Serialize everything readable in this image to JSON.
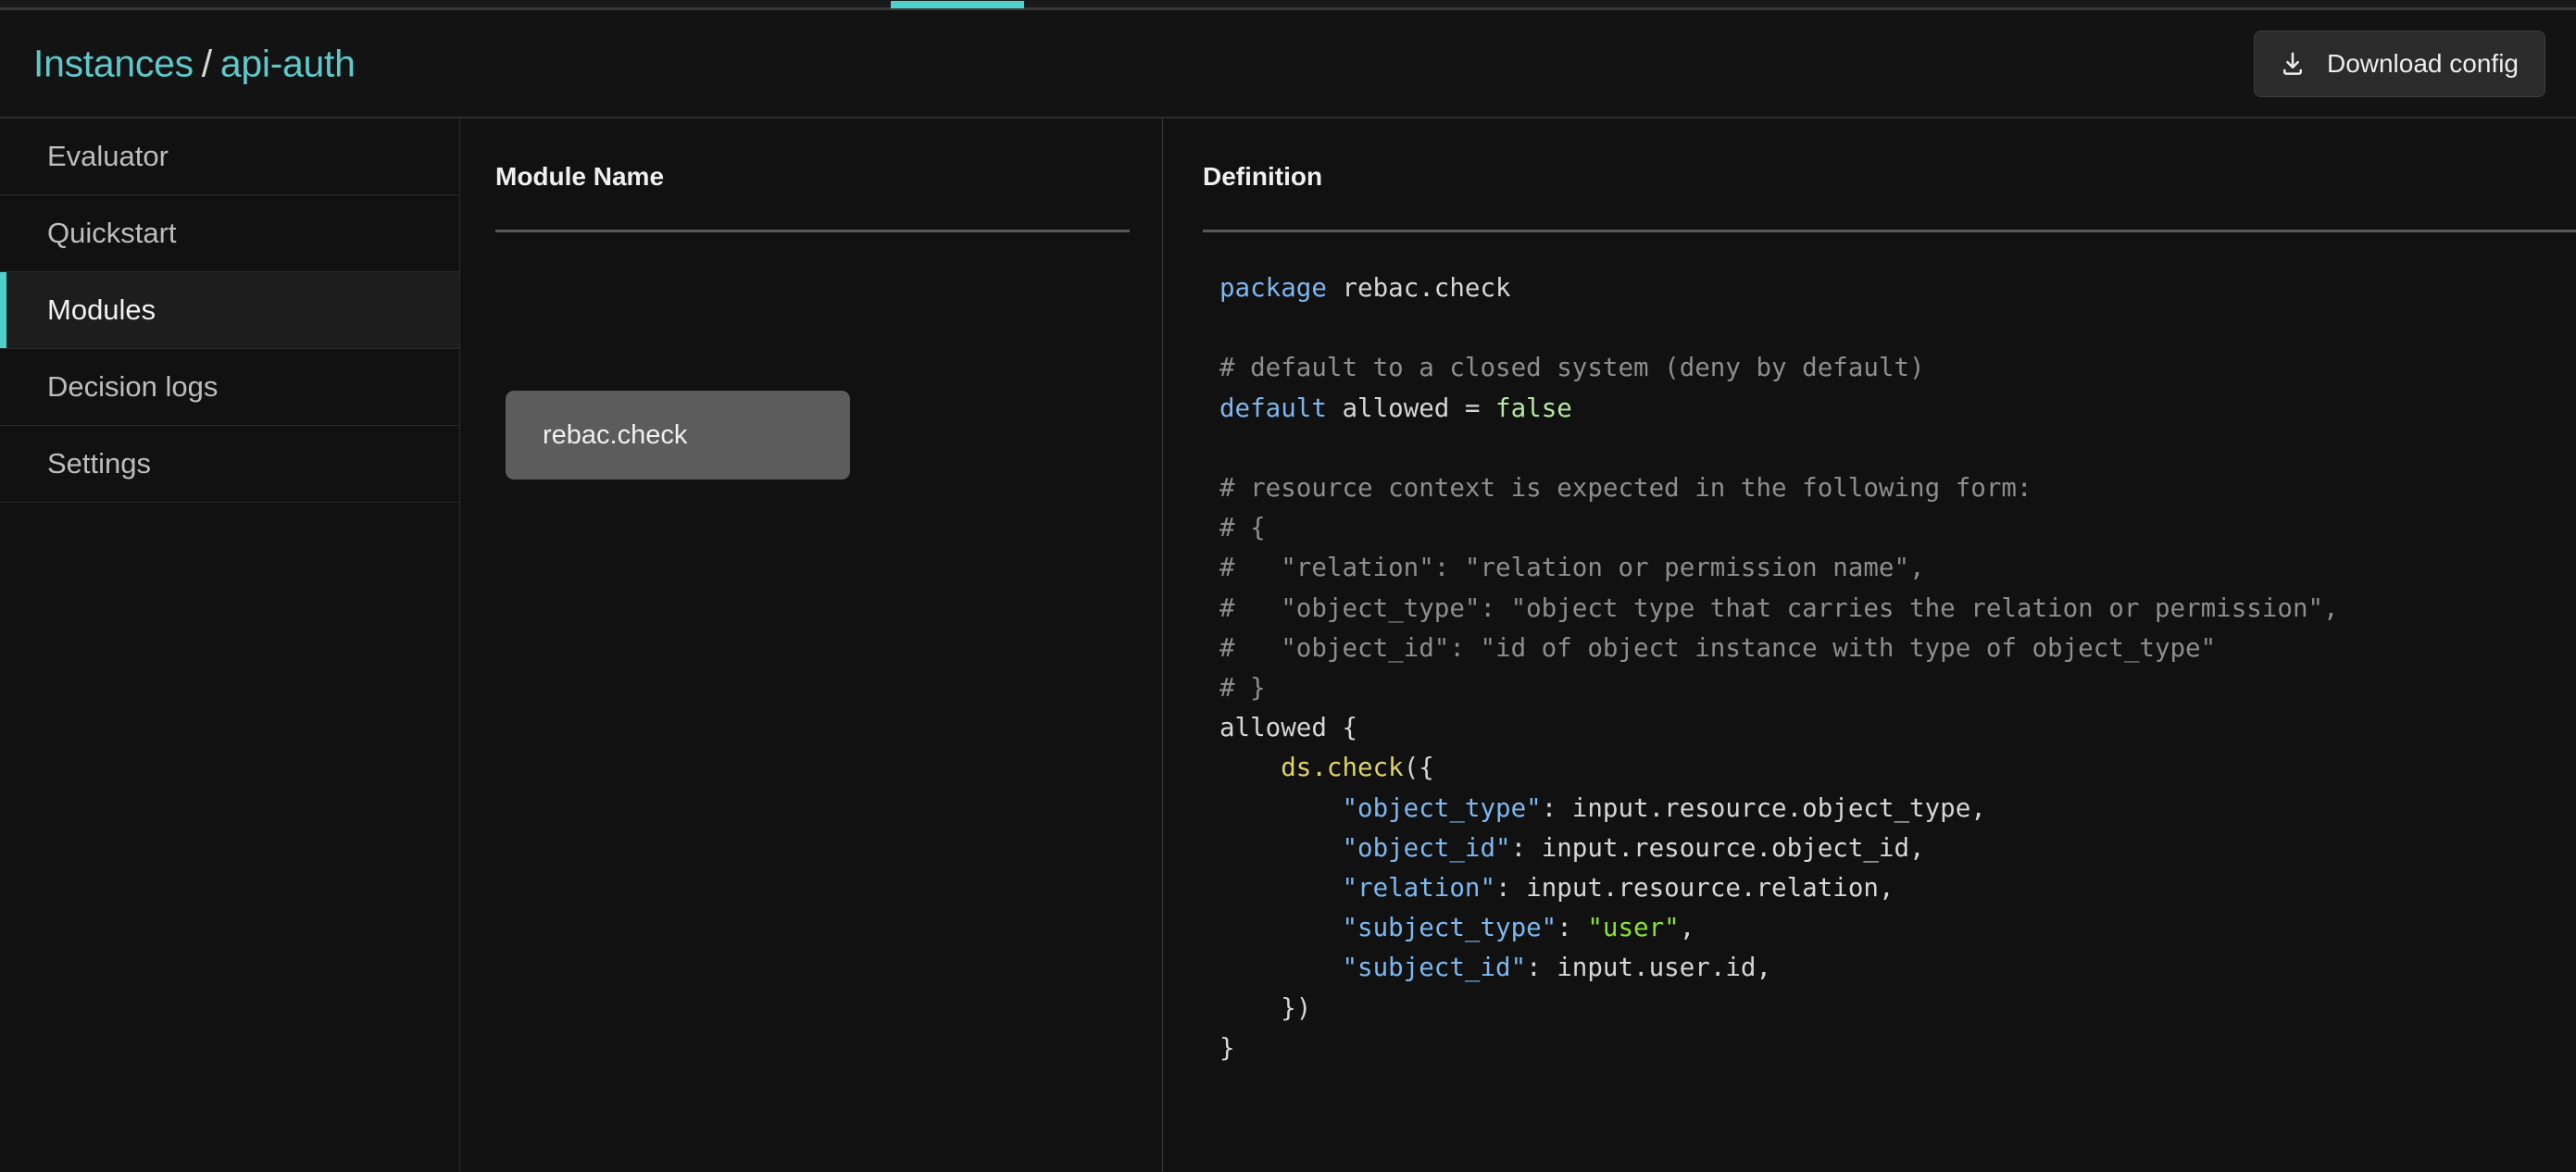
{
  "topbar": {
    "active_tab_indicator": true,
    "accent_color": "#4fd0cc"
  },
  "header": {
    "breadcrumb_root": "Instances",
    "breadcrumb_separator": "/",
    "breadcrumb_current": "api-auth",
    "download_button_label": "Download config",
    "download_icon": "download-icon"
  },
  "sidebar": {
    "items": [
      {
        "label": "Evaluator",
        "active": false
      },
      {
        "label": "Quickstart",
        "active": false
      },
      {
        "label": "Modules",
        "active": true
      },
      {
        "label": "Decision logs",
        "active": false
      },
      {
        "label": "Settings",
        "active": false
      }
    ]
  },
  "modules_column": {
    "header": "Module Name",
    "items": [
      {
        "name": "rebac.check",
        "selected": true
      }
    ]
  },
  "definition_column": {
    "header": "Definition",
    "code_lines": [
      [
        {
          "t": "package",
          "c": "kw"
        },
        {
          "t": " rebac.check",
          "c": "plain"
        }
      ],
      [
        {
          "t": "",
          "c": "plain"
        }
      ],
      [
        {
          "t": "# default to a closed system (deny by default)",
          "c": "cmt"
        }
      ],
      [
        {
          "t": "default",
          "c": "kw"
        },
        {
          "t": " allowed = ",
          "c": "plain"
        },
        {
          "t": "false",
          "c": "bool"
        }
      ],
      [
        {
          "t": "",
          "c": "plain"
        }
      ],
      [
        {
          "t": "# resource context is expected in the following form:",
          "c": "cmt"
        }
      ],
      [
        {
          "t": "# {",
          "c": "cmt"
        }
      ],
      [
        {
          "t": "#   \"relation\": \"relation or permission name\",",
          "c": "cmt"
        }
      ],
      [
        {
          "t": "#   \"object_type\": \"object type that carries the relation or permission\",",
          "c": "cmt"
        }
      ],
      [
        {
          "t": "#   \"object_id\": \"id of object instance with type of object_type\"",
          "c": "cmt"
        }
      ],
      [
        {
          "t": "# }",
          "c": "cmt"
        }
      ],
      [
        {
          "t": "allowed {",
          "c": "plain"
        }
      ],
      [
        {
          "t": "    ",
          "c": "plain"
        },
        {
          "t": "ds.check",
          "c": "fn"
        },
        {
          "t": "({",
          "c": "plain"
        }
      ],
      [
        {
          "t": "        ",
          "c": "plain"
        },
        {
          "t": "\"object_type\"",
          "c": "key"
        },
        {
          "t": ": input.resource.object_type,",
          "c": "plain"
        }
      ],
      [
        {
          "t": "        ",
          "c": "plain"
        },
        {
          "t": "\"object_id\"",
          "c": "key"
        },
        {
          "t": ": input.resource.object_id,",
          "c": "plain"
        }
      ],
      [
        {
          "t": "        ",
          "c": "plain"
        },
        {
          "t": "\"relation\"",
          "c": "key"
        },
        {
          "t": ": input.resource.relation,",
          "c": "plain"
        }
      ],
      [
        {
          "t": "        ",
          "c": "plain"
        },
        {
          "t": "\"subject_type\"",
          "c": "key"
        },
        {
          "t": ": ",
          "c": "plain"
        },
        {
          "t": "\"user\"",
          "c": "str"
        },
        {
          "t": ",",
          "c": "plain"
        }
      ],
      [
        {
          "t": "        ",
          "c": "plain"
        },
        {
          "t": "\"subject_id\"",
          "c": "key"
        },
        {
          "t": ": input.user.id,",
          "c": "plain"
        }
      ],
      [
        {
          "t": "    })",
          "c": "plain"
        }
      ],
      [
        {
          "t": "}",
          "c": "plain"
        }
      ]
    ]
  }
}
